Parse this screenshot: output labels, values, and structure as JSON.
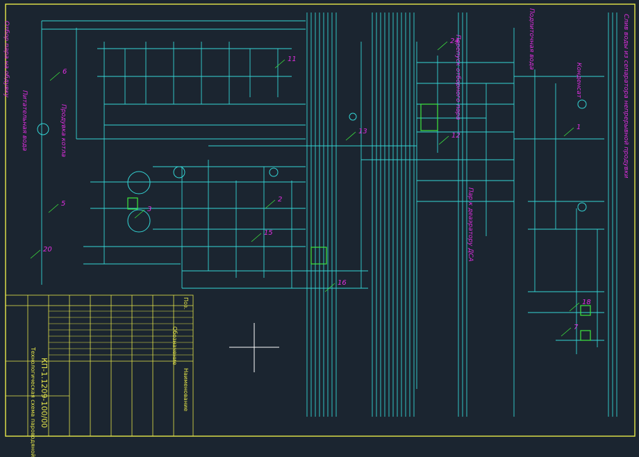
{
  "drawing": {
    "title_block": {
      "doc_code": "КП-1.1209-100/00",
      "sheet_title": "Технологическая схема пароводяной",
      "columns": [
        "Поз.",
        "Обозначение",
        "Наименование"
      ]
    },
    "labels_left": [
      "Отбор пара на обдувку",
      "Питательная вода",
      "Продувка котла"
    ],
    "labels_mid": [
      "Перепуск отборного пара",
      "Пар к деаэратору ДСА"
    ],
    "labels_right": [
      "Слив воды из сепаратора непрерывной продувки",
      "Подпиточная вода",
      "Конденсат"
    ],
    "callouts": [
      "1",
      "2",
      "3",
      "5",
      "6",
      "7",
      "11",
      "12",
      "13",
      "15",
      "16",
      "18",
      "20",
      "24"
    ],
    "colors": {
      "background": "#1b2530",
      "line": "#34d6d6",
      "text": "#e02ee0",
      "frame": "#e8e84a",
      "equipment": "#3ee83e",
      "white": "#ffffff"
    }
  }
}
